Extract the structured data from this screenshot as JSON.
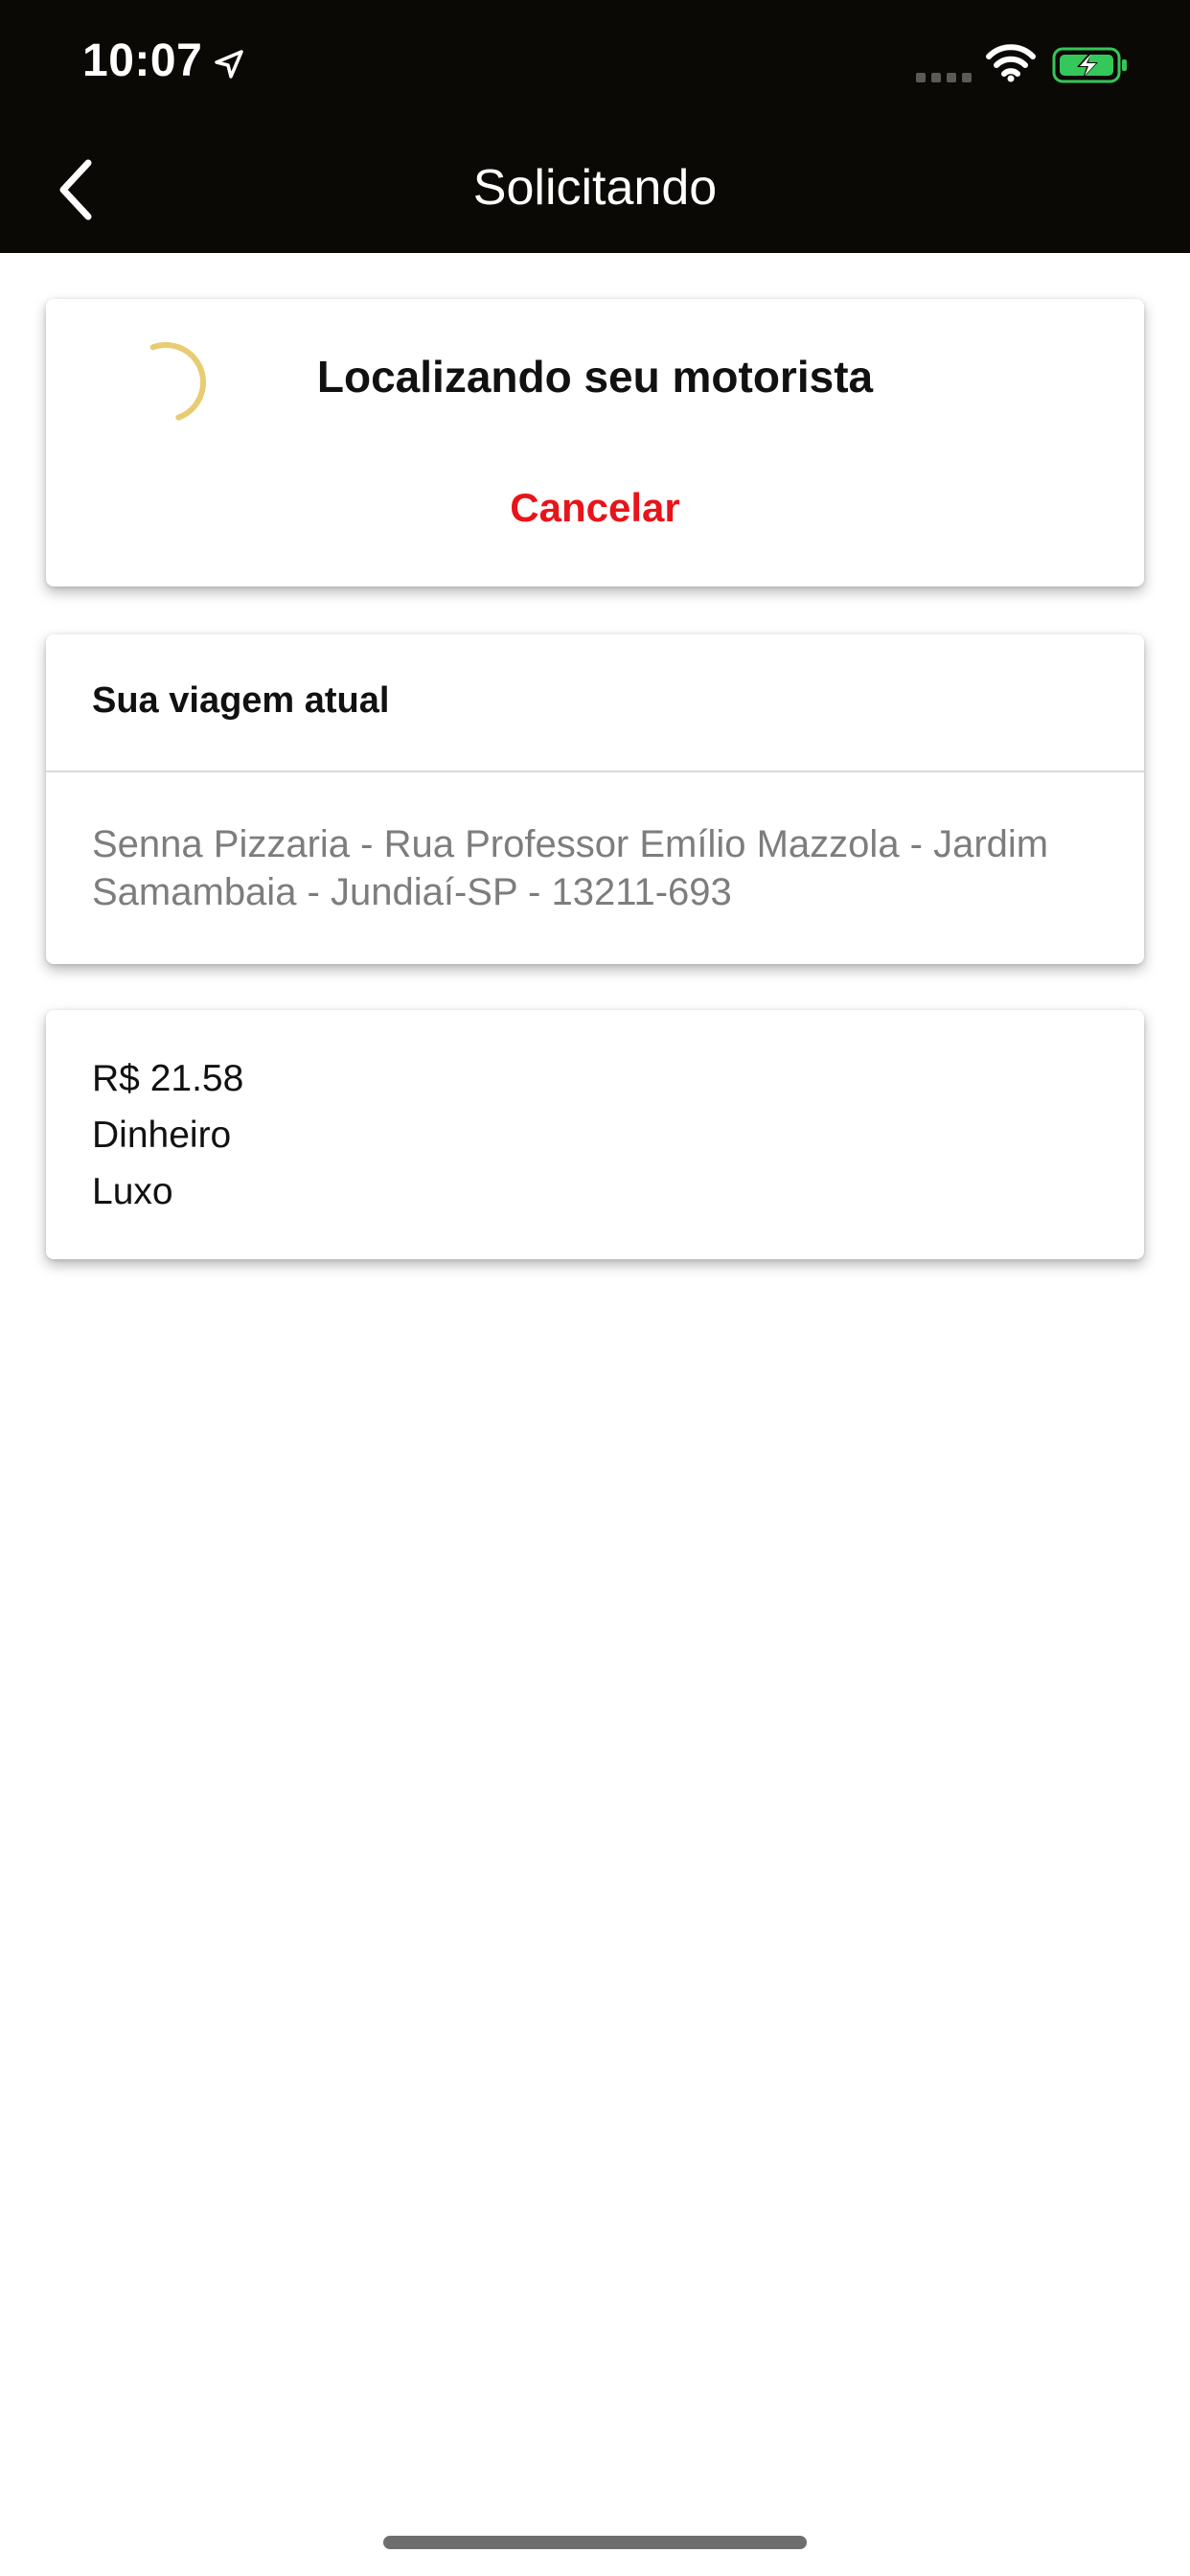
{
  "status_bar": {
    "time": "10:07",
    "icons": [
      "location-arrow-icon",
      "cellular-signal-icon",
      "wifi-icon",
      "battery-charging-icon"
    ],
    "battery_color": "#34c759"
  },
  "nav": {
    "title": "Solicitando",
    "back_icon": "chevron-left-icon",
    "background": "#0b0905"
  },
  "request_card": {
    "title": "Localizando seu motorista",
    "cancel_label": "Cancelar",
    "cancel_color": "#e8141a",
    "spinner_color": "#e8cc72"
  },
  "trip_card": {
    "header": "Sua viagem atual",
    "address": "Senna Pizzaria - Rua Professor Emílio Mazzola - Jardim Samambaia - Jundiaí-SP - 13211-693"
  },
  "payment_card": {
    "price": "R$ 21.58",
    "method": "Dinheiro",
    "category": "Luxo"
  }
}
